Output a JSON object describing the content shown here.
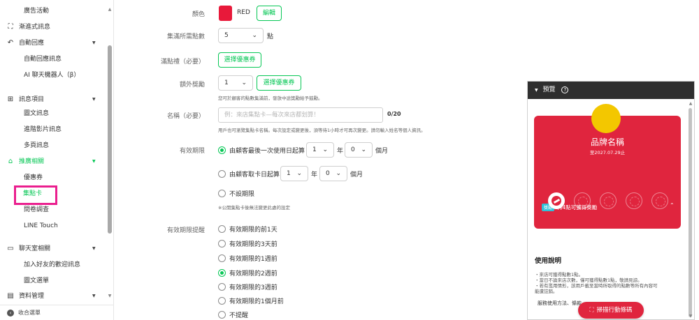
{
  "sidebar": {
    "items": [
      {
        "label": "廣告活動",
        "level": "sub"
      },
      {
        "label": "漸進式訊息",
        "level": "top",
        "icon": "hierarchy-icon"
      },
      {
        "label": "自動回應",
        "level": "top",
        "icon": "reply-icon"
      },
      {
        "label": "自動回應訊息",
        "level": "sub"
      },
      {
        "label": "AI 聊天機器人（β）",
        "level": "sub"
      },
      {
        "label": "訊息項目",
        "level": "top",
        "icon": "plus-box-icon"
      },
      {
        "label": "圖文訊息",
        "level": "sub"
      },
      {
        "label": "進階影片訊息",
        "level": "sub"
      },
      {
        "label": "多頁訊息",
        "level": "sub"
      },
      {
        "label": "推廣相關",
        "level": "top",
        "icon": "store-icon"
      },
      {
        "label": "優惠券",
        "level": "sub"
      },
      {
        "label": "集點卡",
        "level": "sub"
      },
      {
        "label": "問卷調查",
        "level": "sub"
      },
      {
        "label": "LINE Touch",
        "level": "sub"
      },
      {
        "label": "聊天室相關",
        "level": "top",
        "icon": "chat-icon"
      },
      {
        "label": "加入好友的歡迎訊息",
        "level": "sub"
      },
      {
        "label": "圖文選單",
        "level": "sub"
      },
      {
        "label": "資料管理",
        "level": "top",
        "icon": "data-icon"
      }
    ],
    "collapse_label": "收合選單"
  },
  "form": {
    "color": {
      "label": "顏色",
      "value": "RED",
      "swatch": "#e8193a",
      "edit_label": "編輯"
    },
    "points_required": {
      "label": "集滿所需點數",
      "value": "5",
      "unit": "點"
    },
    "full_reward": {
      "label": "滿點禮（必要）",
      "button": "選擇優惠券"
    },
    "extra_reward": {
      "label": "額外獎勵",
      "value": "1",
      "button": "選擇優惠券",
      "hint": "您可於顧客的點數集滿前，發放中途獎勵給予鼓勵。"
    },
    "name": {
      "label": "名稱（必要）",
      "placeholder": "例：來店集點卡—每次來店都划算！",
      "counter": "0/20",
      "hint": "用戶也可瀏覽集點卡名稱。每次設定或變更後，須等待1小時才可再次變更。請勿輸入姓名等個人資訊。"
    },
    "validity": {
      "label": "有效期限",
      "option1": "由顧客最後一次使用日起算",
      "option1_year": "1",
      "option1_month": "0",
      "option2": "由顧客取卡日起算",
      "option2_year": "1",
      "option2_month": "0",
      "year_unit": "年",
      "month_unit": "個月",
      "option3": "不設期限",
      "note": "※公開集點卡後無法變更此處的設定"
    },
    "reminder": {
      "label": "有效期限提醒",
      "options": [
        "有效期限的前1天",
        "有效期限的3天前",
        "有效期限的1週前",
        "有效期限的2週前",
        "有效期限的3週前",
        "有效期限的1個月前",
        "不提醒"
      ],
      "selected_index": 3
    }
  },
  "preview": {
    "title": "預覽",
    "card": {
      "brand_name": "品牌名稱",
      "expiry": "至2027.07.29止",
      "badge": "獎勵",
      "reward_text": "再4點可獲得獎勵",
      "stamps_total": 5,
      "stamps_done": 1,
      "color": "#e0253e",
      "logo_color": "#f3c700"
    },
    "usage_title": "使用說明",
    "usage_lines": [
      "・來店可獲得點數1點。",
      "・當日不論來店次數，僅可獲得點數1點，敬請見諒。",
      "・若有濫用情形，該用戶載至當時所取得的點數等所有內容可",
      "能遭註銷。"
    ],
    "usage_more": "服務使用方法、條款",
    "scan_button": "掃描行動條碼"
  },
  "colors": {
    "accent": "#06c755",
    "highlight": "#ea1e8e"
  }
}
